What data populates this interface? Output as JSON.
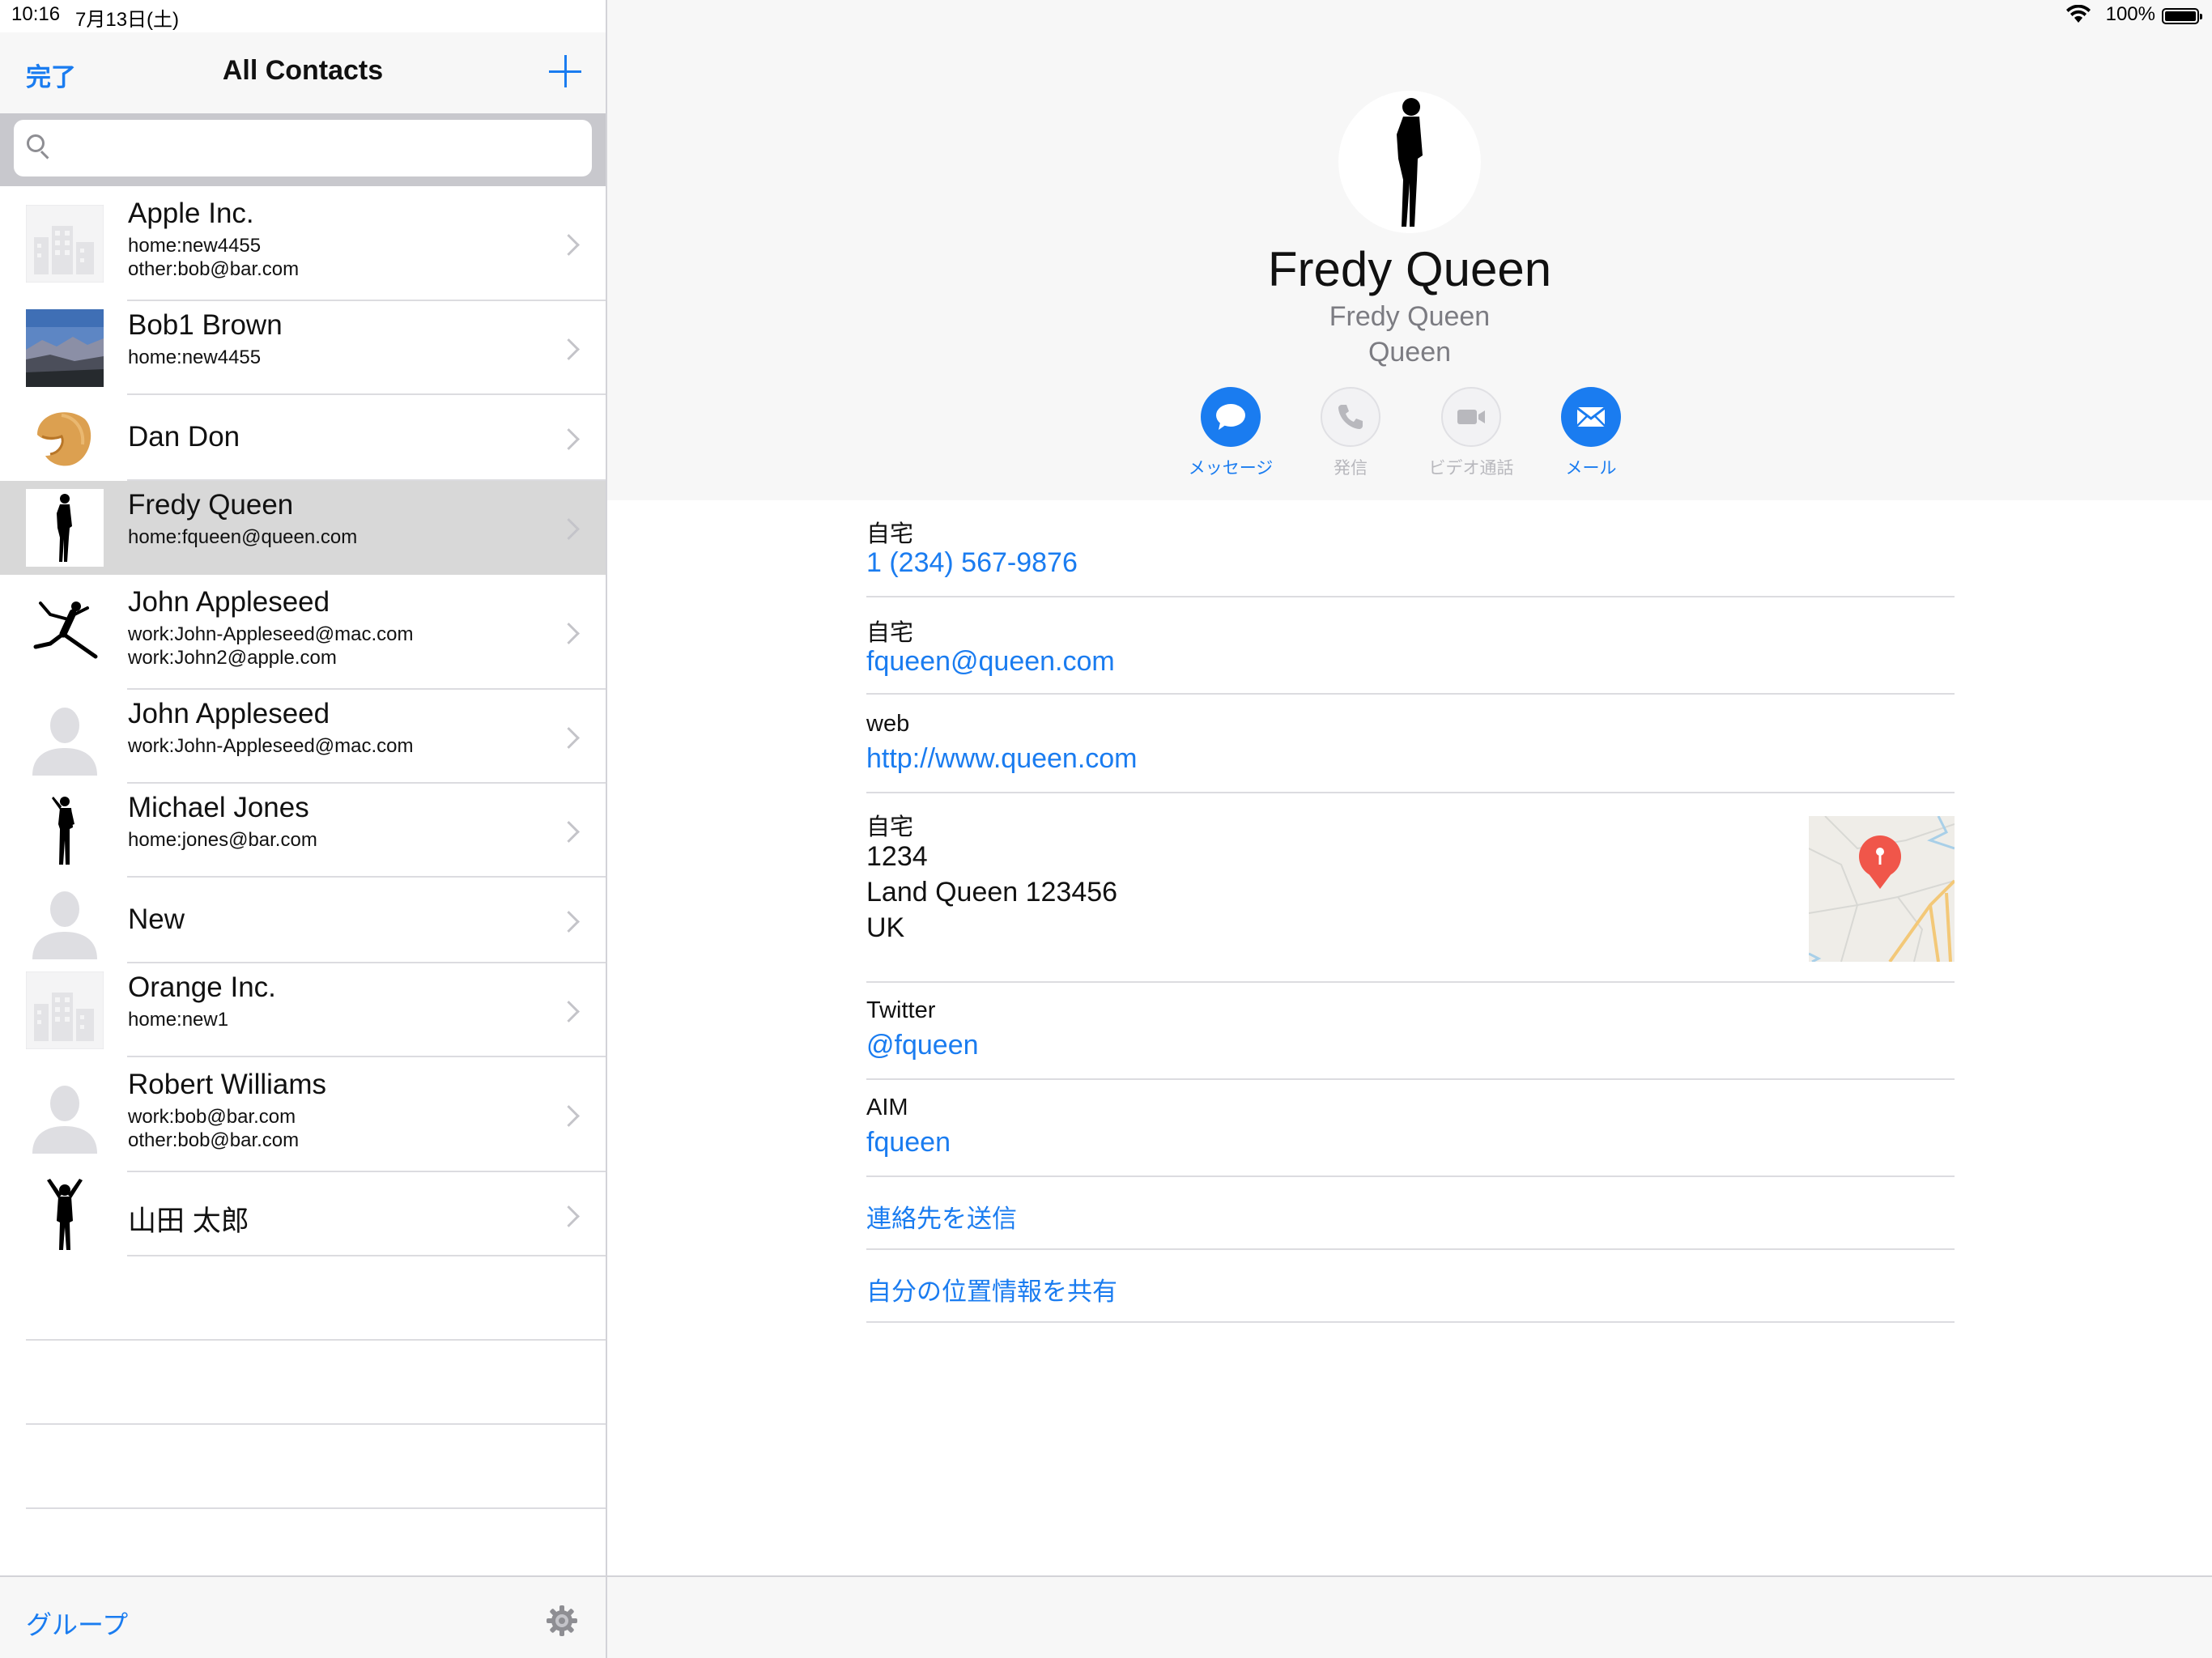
{
  "status": {
    "time": "10:16",
    "date": "7月13日(土)",
    "battery": "100%",
    "battery_level": 1.0
  },
  "list_pane": {
    "done_label": "完了",
    "title": "All Contacts",
    "add_icon": "plus-icon",
    "search_placeholder": "",
    "groups_label": "グループ",
    "settings_icon": "gear-icon",
    "contacts": [
      {
        "name": "Apple Inc.",
        "lines": [
          "home:new4455",
          "other:bob@bar.com"
        ],
        "avatar": "company-placeholder-icon"
      },
      {
        "name": "Bob1 Brown",
        "lines": [
          "home:new4455"
        ],
        "avatar": "landscape-photo"
      },
      {
        "name": "Dan Don",
        "lines": [],
        "avatar": "fortune-cookie-photo"
      },
      {
        "name": "Fredy Queen",
        "lines": [
          "home:fqueen@queen.com"
        ],
        "avatar": "standing-silhouette",
        "selected": true
      },
      {
        "name": "John Appleseed",
        "lines": [
          "work:John-Appleseed@mac.com",
          "work:John2@apple.com"
        ],
        "avatar": "jumping-silhouette"
      },
      {
        "name": "John Appleseed",
        "lines": [
          "work:John-Appleseed@mac.com"
        ],
        "avatar": "person-placeholder-icon"
      },
      {
        "name": "Michael Jones",
        "lines": [
          "home:jones@bar.com"
        ],
        "avatar": "posing-silhouette"
      },
      {
        "name": "New",
        "lines": [],
        "avatar": "person-placeholder-icon"
      },
      {
        "name": "Orange Inc.",
        "lines": [
          "home:new1"
        ],
        "avatar": "company-placeholder-icon"
      },
      {
        "name": "Robert Williams",
        "lines": [
          "work:bob@bar.com",
          "other:bob@bar.com"
        ],
        "avatar": "person-placeholder-icon"
      },
      {
        "name": "山田 太郎",
        "lines": [],
        "avatar": "arms-up-silhouette"
      }
    ]
  },
  "detail": {
    "name": "Fredy Queen",
    "subtitle1": "Fredy Queen",
    "subtitle2": "Queen",
    "actions": [
      {
        "label": "メッセージ",
        "icon": "message-bubble-icon",
        "enabled": true
      },
      {
        "label": "発信",
        "icon": "phone-icon",
        "enabled": false
      },
      {
        "label": "ビデオ通話",
        "icon": "video-camera-icon",
        "enabled": false
      },
      {
        "label": "メール",
        "icon": "envelope-icon",
        "enabled": true
      }
    ],
    "phone": {
      "label": "自宅",
      "value": "1 (234) 567-9876"
    },
    "email": {
      "label": "自宅",
      "value": "fqueen@queen.com"
    },
    "web": {
      "label": "web",
      "value": "http://www.queen.com"
    },
    "address": {
      "label": "自宅",
      "line1": "1234",
      "line2": "Land Queen 123456",
      "line3": "UK"
    },
    "twitter": {
      "label": "Twitter",
      "value": "@fqueen"
    },
    "aim": {
      "label": "AIM",
      "value": "fqueen"
    },
    "send_contact": "連絡先を送信",
    "share_location": "自分の位置情報を共有"
  },
  "colors": {
    "accent": "#1a7cf0",
    "selected_row": "#d8d8d8",
    "map_pin": "#f0564a"
  }
}
